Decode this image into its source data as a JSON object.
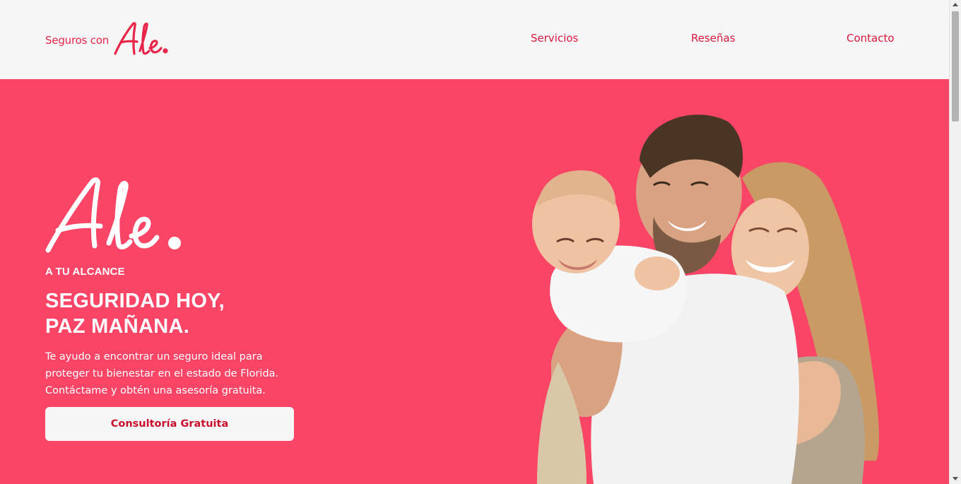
{
  "header": {
    "brand_text": "Seguros con",
    "brand_logo_word": "Ale.",
    "nav": [
      {
        "label": "Servicios"
      },
      {
        "label": "Reseñas"
      },
      {
        "label": "Contacto"
      }
    ]
  },
  "hero": {
    "logo_word": "Ale.",
    "eyebrow": "A TU ALCANCE",
    "headline_line1": "SEGURIDAD HOY,",
    "headline_line2": "PAZ MAÑANA.",
    "description": "Te ayudo a encontrar un seguro ideal para proteger tu bienestar en el estado de Florida. Contáctame y obtén una asesoría gratuita.",
    "cta_label": "Consultoría Gratuita"
  },
  "colors": {
    "brand_red": "#e8264a",
    "hero_background": "#fb4567",
    "header_background": "#f6f6f6",
    "button_background": "#f6f6f6",
    "button_text": "#c8102e"
  }
}
